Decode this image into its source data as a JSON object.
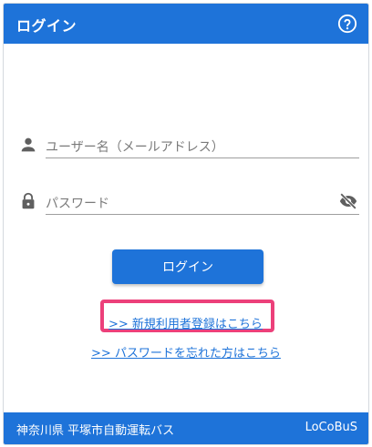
{
  "header": {
    "title": "ログイン"
  },
  "form": {
    "username_placeholder": "ユーザー名（メールアドレス）",
    "password_placeholder": "パスワード",
    "login_button": "ログイン"
  },
  "links": {
    "register": ">> 新規利用者登録はこちら",
    "forgot_password": ">> パスワードを忘れた方はこちら"
  },
  "footer": {
    "operator": "神奈川県 平塚市自動運転バス",
    "brand": "LoCoBuS"
  },
  "colors": {
    "primary": "#1e73d9",
    "highlight": "#ec407a"
  },
  "icons": {
    "help": "help-icon",
    "user": "user-icon",
    "lock": "lock-icon",
    "visibility_off": "eye-off-icon"
  }
}
